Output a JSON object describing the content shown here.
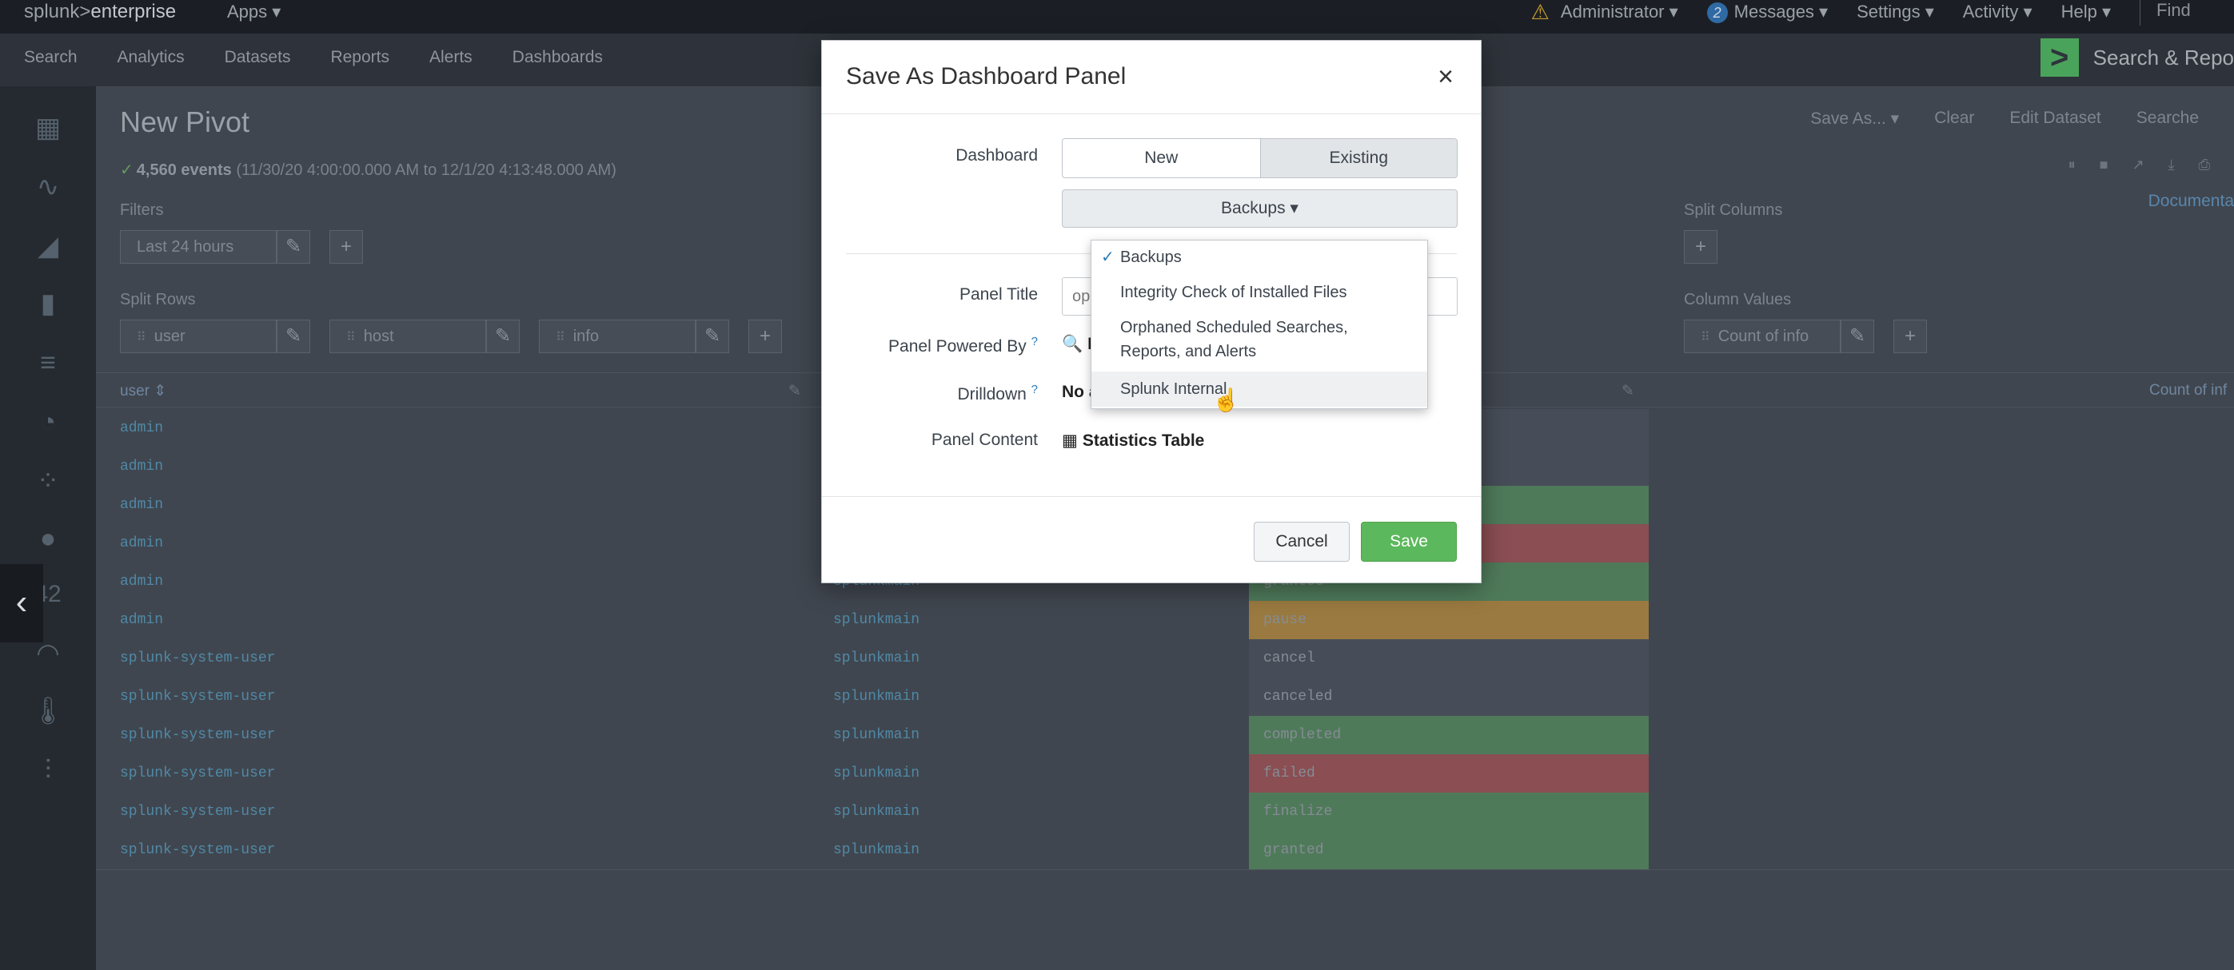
{
  "topbar": {
    "logo_a": "splunk>",
    "logo_b": "enterprise",
    "apps": "Apps ▾",
    "user": "Administrator ▾",
    "messages_count": "2",
    "messages": "Messages ▾",
    "settings": "Settings ▾",
    "activity": "Activity ▾",
    "help": "Help ▾",
    "find": "Find"
  },
  "appbar": {
    "nav": [
      "Search",
      "Analytics",
      "Datasets",
      "Reports",
      "Alerts",
      "Dashboards"
    ],
    "app_name": "Search & Repo"
  },
  "page": {
    "title": "New Pivot",
    "events_count": "4,560 events",
    "events_range": "(11/30/20 4:00:00.000 AM to 12/1/20 4:13:48.000 AM)",
    "actions": [
      "Save As... ▾",
      "Clear",
      "Edit Dataset",
      "Searche"
    ],
    "doc_link": "Documenta",
    "filters_label": "Filters",
    "filter_value": "Last 24 hours",
    "split_rows_label": "Split Rows",
    "split_rows": [
      "user",
      "host",
      "info"
    ],
    "split_columns_label": "Split Columns",
    "column_values_label": "Column Values",
    "column_value": "Count of info",
    "table_headers": [
      "user ⇕",
      "Count of inf"
    ],
    "rows": [
      {
        "user": "admin",
        "host": "",
        "info": ""
      },
      {
        "user": "admin",
        "host": "",
        "info": ""
      },
      {
        "user": "admin",
        "host": "",
        "info": ""
      },
      {
        "user": "admin",
        "host": "",
        "info": ""
      },
      {
        "user": "admin",
        "host": "splunkmain",
        "info": "granted"
      },
      {
        "user": "admin",
        "host": "splunkmain",
        "info": "pause"
      },
      {
        "user": "splunk-system-user",
        "host": "splunkmain",
        "info": "cancel"
      },
      {
        "user": "splunk-system-user",
        "host": "splunkmain",
        "info": "canceled"
      },
      {
        "user": "splunk-system-user",
        "host": "splunkmain",
        "info": "completed"
      },
      {
        "user": "splunk-system-user",
        "host": "splunkmain",
        "info": "failed"
      },
      {
        "user": "splunk-system-user",
        "host": "splunkmain",
        "info": "finalize"
      },
      {
        "user": "splunk-system-user",
        "host": "splunkmain",
        "info": "granted"
      }
    ],
    "rail_number": "42"
  },
  "modal": {
    "title": "Save As Dashboard Panel",
    "close": "×",
    "dashboard_label": "Dashboard",
    "seg_new": "New",
    "seg_existing": "Existing",
    "dropdown_value": "Backups ▾",
    "panel_title_label": "Panel Title",
    "panel_title_value": "op",
    "powered_by_label": "Panel Powered By",
    "powered_by_value": "In",
    "drilldown_label": "Drilldown",
    "drilldown_value": "No a",
    "content_label": "Panel Content",
    "content_value": "Statistics Table",
    "cancel": "Cancel",
    "save": "Save",
    "help_mark": "?"
  },
  "menu": {
    "items": [
      "Backups",
      "Integrity Check of Installed Files",
      "Orphaned Scheduled Searches,",
      "Reports, and Alerts",
      "Splunk Internal"
    ],
    "checked": "✓"
  },
  "colors": {
    "save_green": "#5cb85c",
    "cell_green": "#4f7a5a",
    "cell_red": "#8a4e53",
    "cell_orange": "#9a7a40",
    "cell_dark": "#474d58"
  }
}
